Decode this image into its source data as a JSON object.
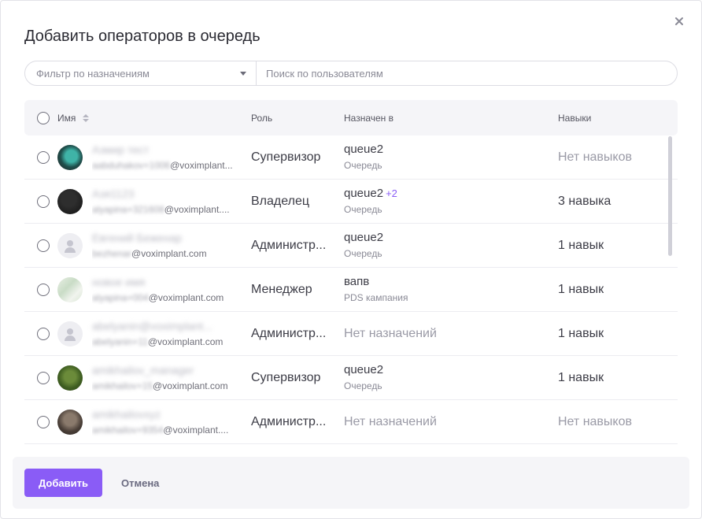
{
  "dialog": {
    "title": "Добавить операторов в очередь"
  },
  "filters": {
    "assignment_filter_label": "Фильтр по назначениям",
    "search_placeholder": "Поиск по пользователям"
  },
  "table": {
    "columns": {
      "name": "Имя",
      "role": "Роль",
      "assigned": "Назначен в",
      "skills": "Навыки"
    },
    "rows": [
      {
        "name": "Азмир тест",
        "email_prefix": "aabduhakov+1006",
        "email_domain": "@voximplant...",
        "avatar": "photo-teal",
        "role": "Супервизор",
        "assigned": "queue2",
        "assigned_extra": "",
        "assigned_type": "Очередь",
        "skills": "Нет навыков",
        "skills_empty": true
      },
      {
        "name": "Азя1123",
        "email_prefix": "alyapina+321608",
        "email_domain": "@voximplant....",
        "avatar": "photo-dark",
        "role": "Владелец",
        "assigned": "queue2",
        "assigned_extra": "+2",
        "assigned_type": "Очередь",
        "skills": "3 навыка",
        "skills_empty": false
      },
      {
        "name": "Евгений Беженар",
        "email_prefix": "bezhenar",
        "email_domain": "@voximplant.com",
        "avatar": "placeholder",
        "role": "Администр...",
        "assigned": "queue2",
        "assigned_extra": "",
        "assigned_type": "Очередь",
        "skills": "1 навык",
        "skills_empty": false
      },
      {
        "name": "новое имя",
        "email_prefix": "alyapina+004",
        "email_domain": "@voximplant.com",
        "avatar": "photo-light",
        "role": "Менеджер",
        "assigned": "вапв",
        "assigned_extra": "",
        "assigned_type": "PDS кампания",
        "skills": "1 навык",
        "skills_empty": false
      },
      {
        "name": "abelyanin@voximplant...",
        "email_prefix": "abelyanin+11",
        "email_domain": "@voximplant.com",
        "avatar": "placeholder",
        "role": "Администр...",
        "assigned": "Нет назначений",
        "assigned_extra": "",
        "assigned_type": "",
        "skills": "1 навык",
        "skills_empty": false
      },
      {
        "name": "amikhailov_manager",
        "email_prefix": "amikhailov+15",
        "email_domain": "@voximplant.com",
        "avatar": "photo-green",
        "role": "Супервизор",
        "assigned": "queue2",
        "assigned_extra": "",
        "assigned_type": "Очередь",
        "skills": "1 навык",
        "skills_empty": false
      },
      {
        "name": "amikhailovxyz",
        "email_prefix": "amikhailov+9354",
        "email_domain": "@voximplant....",
        "avatar": "photo-brown",
        "role": "Администр...",
        "assigned": "Нет назначений",
        "assigned_extra": "",
        "assigned_type": "",
        "skills": "Нет навыков",
        "skills_empty": true
      }
    ]
  },
  "footer": {
    "add_label": "Добавить",
    "cancel_label": "Отмена"
  },
  "colors": {
    "accent": "#8a5cf6",
    "muted_text": "#9a9aa6"
  },
  "icons": {
    "close": "close-icon",
    "dropdown": "chevron-down-icon",
    "sort": "sort-icon",
    "user_placeholder": "user-icon"
  }
}
